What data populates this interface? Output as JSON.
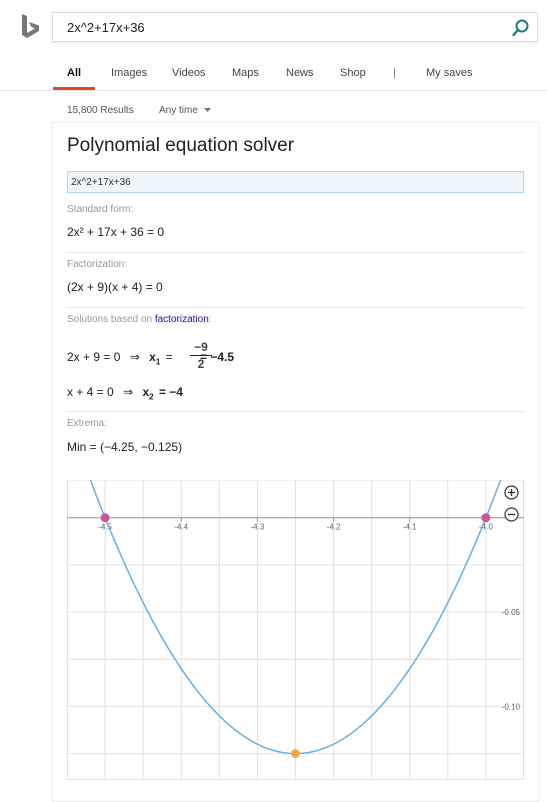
{
  "search": {
    "query": "2x^2+17x+36"
  },
  "nav": {
    "tabs": [
      {
        "label": "All",
        "active": true
      },
      {
        "label": "Images"
      },
      {
        "label": "Videos"
      },
      {
        "label": "Maps"
      },
      {
        "label": "News"
      },
      {
        "label": "Shop"
      }
    ],
    "separator": "|",
    "my_saves": "My saves"
  },
  "results": {
    "count": "15,800 Results",
    "time_filter": "Any time"
  },
  "solver": {
    "title": "Polynomial equation solver",
    "input_value": "2x^2+17x+36",
    "standard_form_label": "Standard form:",
    "standard_form": "2x² + 17x + 36 = 0",
    "factorization_label": "Factorization:",
    "factorization": "(2x + 9)(x + 4) = 0",
    "solutions_label_prefix": "Solutions based on ",
    "solutions_link": "factorization",
    "solutions_label_suffix": ":",
    "sol1_eq": "2x + 9 = 0",
    "arrow": "⇒",
    "sol1_var": "x",
    "sol1_sub": "1",
    "sol1_eqsign": "=",
    "sol1_num": "−9",
    "sol1_den": "2",
    "sol1_result": "= −4.5",
    "sol2_eq": "x + 4 = 0",
    "sol2_var": "x",
    "sol2_sub": "2",
    "sol2_result": "= −4",
    "extrema_label": "Extrema:",
    "extrema": "Min = (−4.25, −0.125)"
  },
  "chart_data": {
    "type": "line",
    "function": "2x^2+17x+36",
    "x_ticks": [
      "-4.5",
      "-4.4",
      "-4.3",
      "-4.2",
      "-4.1",
      "-4.0"
    ],
    "y_ticks": [
      "-0.05",
      "-0.10"
    ],
    "xlim": [
      -4.55,
      -3.95
    ],
    "ylim": [
      -0.139,
      0.02
    ],
    "roots": [
      [
        -4.5,
        0
      ],
      [
        -4.0,
        0
      ]
    ],
    "minimum": [
      -4.25,
      -0.125
    ],
    "colors": {
      "curve": "#6aaee3",
      "root": "#c45a90",
      "min": "#f5a84a",
      "grid": "#e2e2e2",
      "axis": "#999999"
    },
    "zoom_in": "+",
    "zoom_out": "−"
  }
}
